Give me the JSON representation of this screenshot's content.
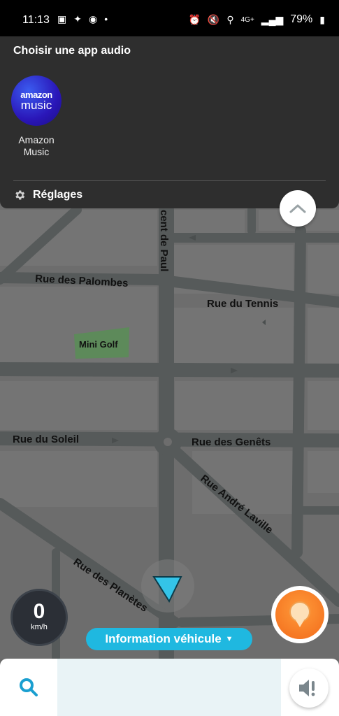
{
  "status_bar": {
    "time": "11:13",
    "battery": "79%",
    "network": "4G+",
    "dot": "•"
  },
  "audio_panel": {
    "title": "Choisir une app audio",
    "apps": [
      {
        "logo_line1": "amazon",
        "logo_line2": "music",
        "name_line1": "Amazon",
        "name_line2": "Music"
      }
    ],
    "settings_label": "Réglages"
  },
  "map": {
    "streets": [
      "cent de Paul",
      "Rue des Palombes",
      "Rue du Tennis",
      "Mini Golf",
      "Rue du Soleil",
      "Rue des Genêts",
      "Rue André Laville",
      "Rue des Planètes"
    ]
  },
  "speedometer": {
    "value": "0",
    "unit": "km/h"
  },
  "vehicle_banner": {
    "label": "Information véhicule"
  },
  "icons": {
    "collapse": "chevron-up-icon",
    "search": "search-icon",
    "sound": "speaker-alert-icon",
    "report": "report-pin-icon",
    "settings": "gear-icon"
  },
  "colors": {
    "accent": "#1fb8e0",
    "report": "#f26a1a",
    "panel": "#2e2e2e"
  }
}
